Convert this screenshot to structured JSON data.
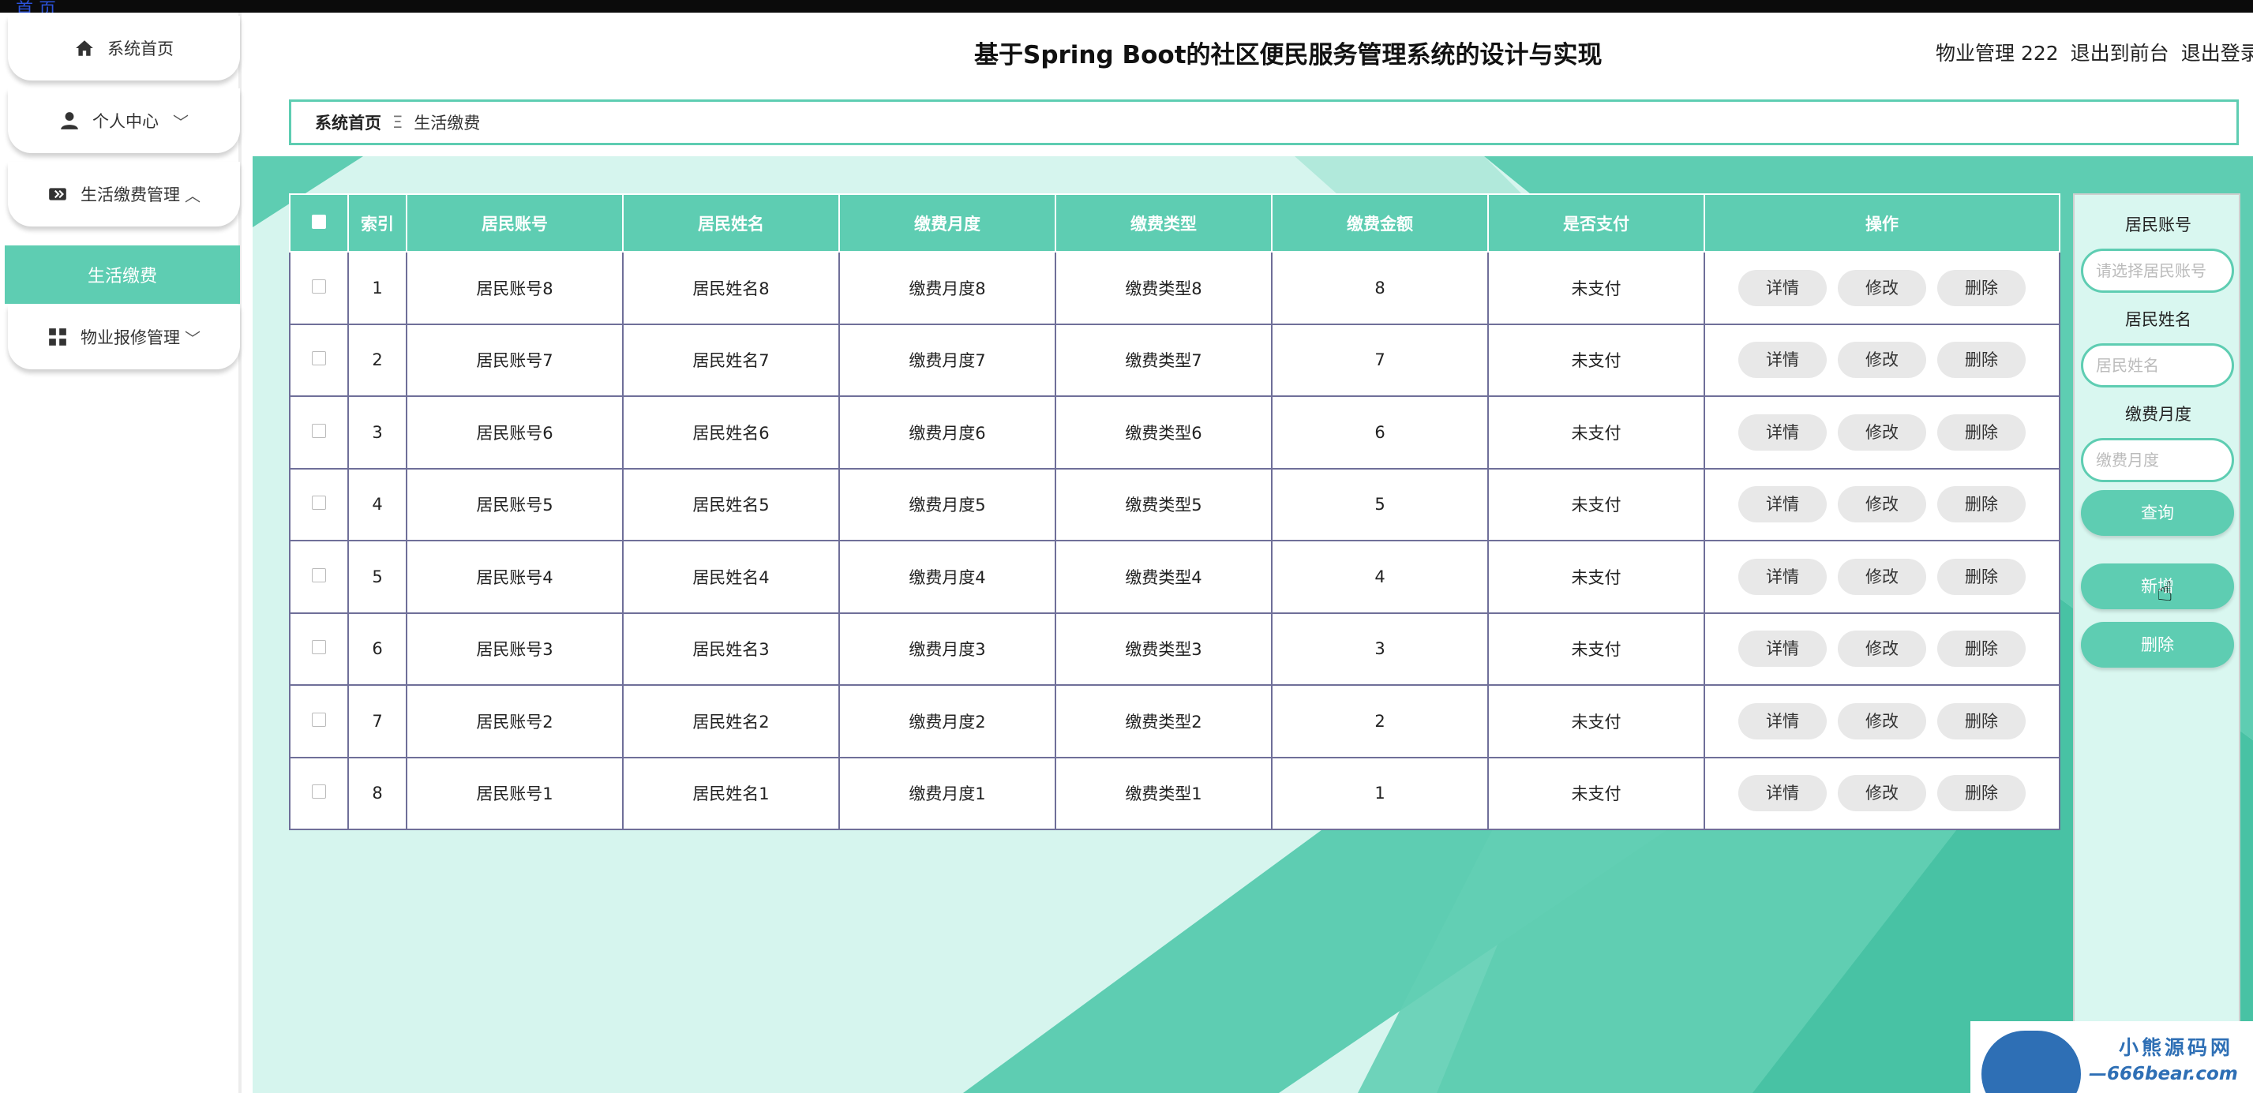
{
  "top_link": "首 页",
  "app_title": "基于Spring Boot的社区便民服务管理系统的设计与实现",
  "header": {
    "user": "物业管理 222",
    "to_front": "退出到前台",
    "logout": "退出登录"
  },
  "sidebar": {
    "items": [
      {
        "label": "系统首页",
        "icon": "home-icon"
      },
      {
        "label": "个人中心",
        "icon": "user-icon",
        "chevron": "﹀"
      },
      {
        "label": "生活缴费管理",
        "icon": "payment-icon",
        "chevron": "︿"
      },
      {
        "label": "物业报修管理",
        "icon": "grid-icon",
        "chevron": "﹀"
      }
    ],
    "active_sub": "生活缴费"
  },
  "breadcrumb": {
    "home": "系统首页",
    "sep": "Ξ",
    "current": "生活缴费"
  },
  "table": {
    "headers": [
      "索引",
      "居民账号",
      "居民姓名",
      "缴费月度",
      "缴费类型",
      "缴费金额",
      "是否支付",
      "操作"
    ],
    "rows": [
      [
        "1",
        "居民账号8",
        "居民姓名8",
        "缴费月度8",
        "缴费类型8",
        "8",
        "未支付"
      ],
      [
        "2",
        "居民账号7",
        "居民姓名7",
        "缴费月度7",
        "缴费类型7",
        "7",
        "未支付"
      ],
      [
        "3",
        "居民账号6",
        "居民姓名6",
        "缴费月度6",
        "缴费类型6",
        "6",
        "未支付"
      ],
      [
        "4",
        "居民账号5",
        "居民姓名5",
        "缴费月度5",
        "缴费类型5",
        "5",
        "未支付"
      ],
      [
        "5",
        "居民账号4",
        "居民姓名4",
        "缴费月度4",
        "缴费类型4",
        "4",
        "未支付"
      ],
      [
        "6",
        "居民账号3",
        "居民姓名3",
        "缴费月度3",
        "缴费类型3",
        "3",
        "未支付"
      ],
      [
        "7",
        "居民账号2",
        "居民姓名2",
        "缴费月度2",
        "缴费类型2",
        "2",
        "未支付"
      ],
      [
        "8",
        "居民账号1",
        "居民姓名1",
        "缴费月度1",
        "缴费类型1",
        "1",
        "未支付"
      ]
    ],
    "ops": [
      "详情",
      "修改",
      "删除"
    ]
  },
  "search": {
    "account_label": "居民账号",
    "account_placeholder": "请选择居民账号",
    "name_label": "居民姓名",
    "name_placeholder": "居民姓名",
    "month_label": "缴费月度",
    "month_placeholder": "缴费月度",
    "query_btn": "查询",
    "add_btn": "新增",
    "delete_btn": "删除"
  },
  "watermark": {
    "line1": "小熊源码网",
    "line2": "—666bear.com—"
  },
  "colors": {
    "accent": "#5ecdb2",
    "bg_light": "#d6f5ee",
    "border": "#6f6f99"
  }
}
